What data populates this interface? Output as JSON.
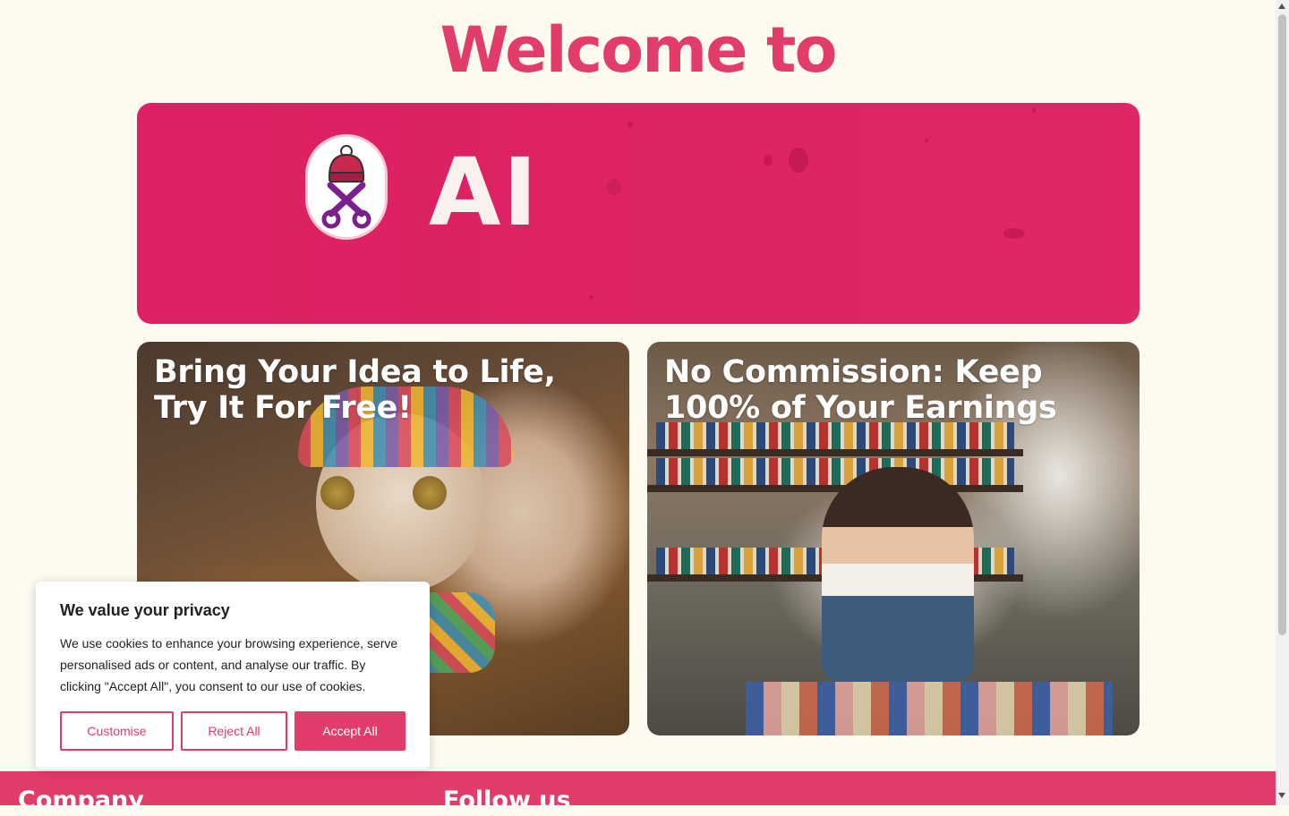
{
  "header": {
    "welcome": "Welcome to"
  },
  "hero": {
    "logo_text": "AI",
    "logo_icon": "hat-scissors-icon"
  },
  "cards": [
    {
      "title": "Bring Your Idea to Life, Try It For Free!",
      "image": "knitted-doll-image"
    },
    {
      "title": "No Commission: Keep 100% of Your Earnings",
      "image": "artisan-workshop-image"
    }
  ],
  "footer": {
    "company": "Company",
    "follow": "Follow us"
  },
  "cookie_banner": {
    "title": "We value your privacy",
    "text": "We use cookies to enhance your browsing experience, serve personalised ads or content, and analyse our traffic. By clicking \"Accept All\", you consent to our use of cookies.",
    "customise": "Customise",
    "reject": "Reject All",
    "accept": "Accept All"
  },
  "colors": {
    "brand_pink": "#e23c6a",
    "hero_pink": "#dc2063",
    "background": "#fdfbef"
  }
}
